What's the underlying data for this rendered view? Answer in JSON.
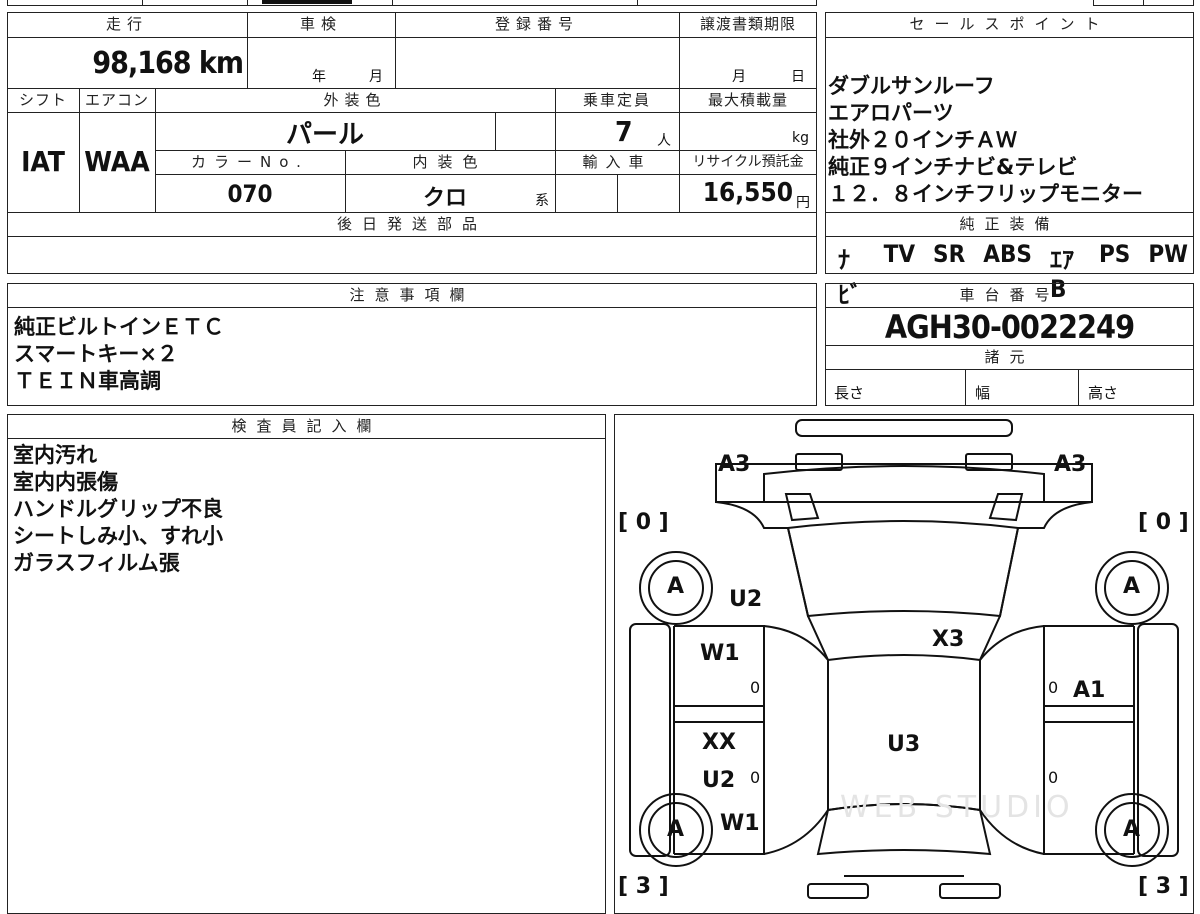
{
  "top": {
    "mileage_header": "走行",
    "shaken_header": "車検",
    "plate_header": "登録番号",
    "transfer_deadline_header": "譲渡書類期限",
    "mileage": "98,168 km",
    "shaken_year": "年",
    "shaken_month": "月",
    "deadline_month": "月",
    "deadline_day": "日",
    "shift_header": "シフト",
    "ac_header": "エアコン",
    "exterior_color_header": "外装色",
    "capacity_header": "乗車定員",
    "max_load_header": "最大積載量",
    "exterior_color": "パール",
    "capacity": "7",
    "capacity_unit": "人",
    "max_load_unit": "kg",
    "shift": "IAT",
    "ac": "WAA",
    "color_no_header": "カラーNo.",
    "interior_color_header": "内装色",
    "import_header": "輸入車",
    "recycle_header": "リサイクル預託金",
    "color_no": "070",
    "interior_color": "クロ",
    "interior_suffix": "系",
    "recycle_fee": "16,550",
    "recycle_unit": "円",
    "later_parts_header": "後日発送部品"
  },
  "sales": {
    "header": "セールスポイント",
    "lines": [
      "ダブルサンルーフ",
      "エアロパーツ",
      "社外２０インチＡＷ",
      "純正９インチナビ&テレビ",
      "１２．８インチフリップモニター"
    ],
    "equipment_header": "純正装備",
    "equipment": [
      "ﾅﾋﾞ",
      "TV",
      "SR",
      "ABS",
      "ｴｱB",
      "PS",
      "PW"
    ]
  },
  "notes": {
    "header": "注意事項欄",
    "lines": [
      "純正ビルトインＥＴＣ",
      "スマートキー×２",
      "ＴＥＩＮ車高調"
    ]
  },
  "chassis": {
    "header": "車台番号",
    "number": "AGH30-0022249",
    "specs_header": "諸元",
    "length": "長さ",
    "width": "幅",
    "height": "高さ"
  },
  "inspector": {
    "header": "検査員記入欄",
    "lines": [
      "室内汚れ",
      "室内内張傷",
      "ハンドルグリップ不良",
      "シートしみ小、すれ小",
      "ガラスフィルム張"
    ]
  },
  "diagram": {
    "a3_left": "A3",
    "a3_right": "A3",
    "bracket_tl": "[ 0 ]",
    "bracket_tr": "[ 0 ]",
    "bracket_bl": "[ 3 ]",
    "bracket_br": "[ 3 ]",
    "tire_fl": "A",
    "tire_fr": "A",
    "tire_rl": "A",
    "tire_rr": "A",
    "u2_top": "U2",
    "x3": "X3",
    "w1_top": "W1",
    "a1": "A1",
    "xx": "XX",
    "u2_bottom": "U2",
    "u3": "U3",
    "w1_bottom": "W1",
    "zero_1": "0",
    "zero_2": "0",
    "zero_3": "0",
    "zero_4": "0",
    "watermark": "WEB STUDIO"
  }
}
